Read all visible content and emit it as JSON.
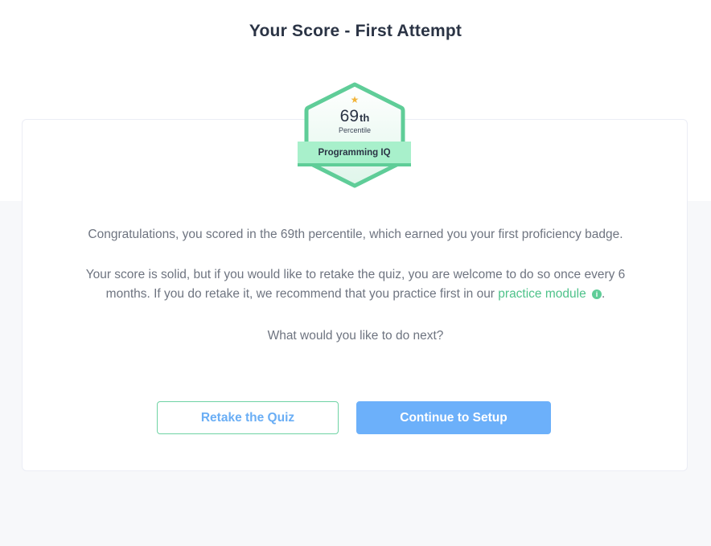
{
  "page": {
    "title": "Your Score - First Attempt"
  },
  "badge": {
    "icon": "star-icon",
    "score_number": "69",
    "score_suffix": "th",
    "score_caption": "Percentile",
    "ribbon_label": "Programming IQ"
  },
  "messages": {
    "congrats": "Congratulations, you scored in the 69th percentile, which earned you your first proficiency badge.",
    "retake_info_before_link": "Your score is solid, but if you would like to retake the quiz, you are welcome to do so once every 6 months. If you do retake it, we recommend that you practice first in our ",
    "practice_link": "practice module",
    "retake_info_after_link": ".",
    "next_question": "What would you like to do next?"
  },
  "actions": {
    "retake_label": "Retake the Quiz",
    "continue_label": "Continue to Setup"
  },
  "colors": {
    "accent_green": "#5fcd98",
    "ribbon_green": "#a8f0cb",
    "primary_blue": "#6cb0fa",
    "title_text": "#2b3445",
    "body_text": "#6e7480",
    "star_gold": "#f2b43a"
  }
}
